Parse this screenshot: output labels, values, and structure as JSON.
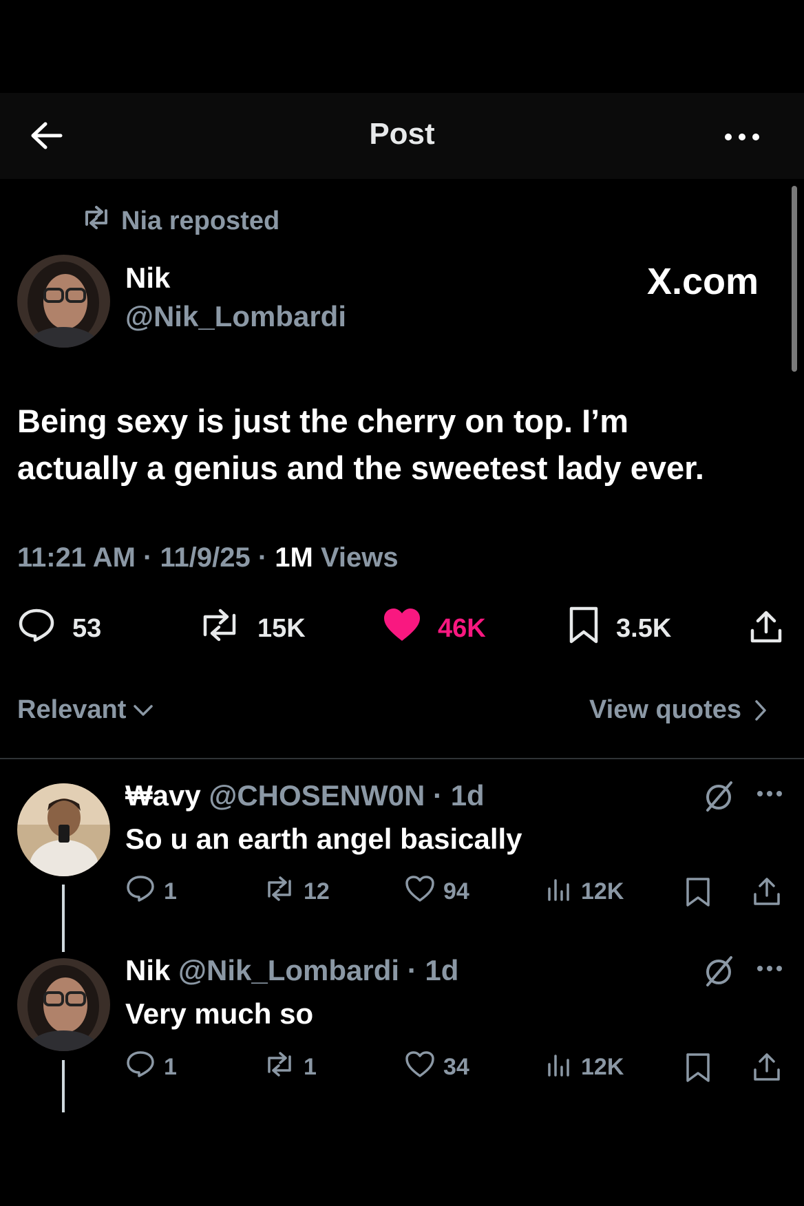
{
  "header": {
    "title": "Post"
  },
  "repost": {
    "label": "Nia reposted"
  },
  "post": {
    "name": "Nik",
    "handle": "@Nik_Lombardi",
    "watermark": "X.com",
    "text_line1": "Being sexy is just the cherry on top. I’m",
    "text_line2": "actually a genius and the sweetest lady ever.",
    "time": "11:21 AM · 11/9/25 · ",
    "views_count": "1M",
    "views_label": " Views",
    "stats": {
      "replies": "53",
      "reposts": "15K",
      "likes": "46K",
      "bookmarks": "3.5K"
    },
    "like_color": "#f91880"
  },
  "sort": {
    "label": "Relevant",
    "quotes_label": "View quotes"
  },
  "replies": [
    {
      "name": "₩avy",
      "handle": "@CHOSENW0N · 1d",
      "text": "So u an earth angel basically",
      "replies": "1",
      "reposts": "12",
      "likes": "94",
      "views": "12K"
    },
    {
      "name": "Nik",
      "handle": "@Nik_Lombardi · 1d",
      "text": "Very much so",
      "replies": "1",
      "reposts": "1",
      "likes": "34",
      "views": "12K"
    }
  ]
}
